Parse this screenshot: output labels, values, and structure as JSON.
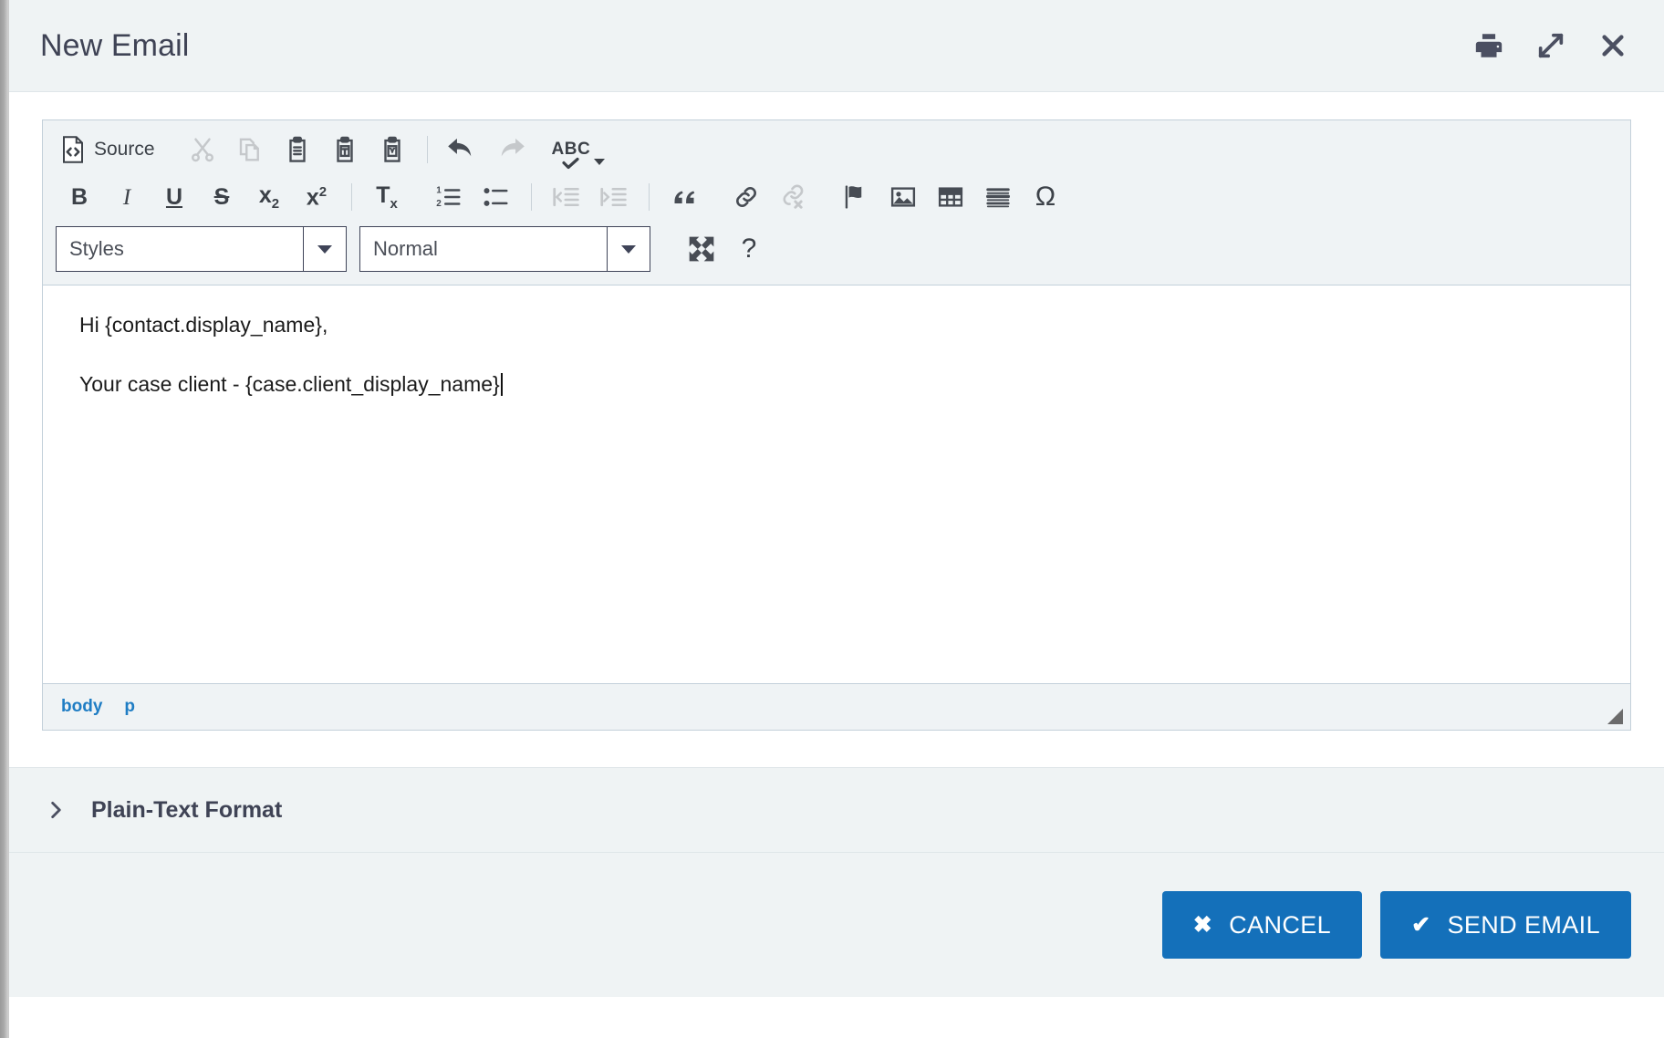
{
  "header": {
    "title": "New Email",
    "actions": [
      {
        "name": "print-icon",
        "label": "Print"
      },
      {
        "name": "expand-icon",
        "label": "Expand"
      },
      {
        "name": "close-icon",
        "label": "Close"
      }
    ]
  },
  "toolbar": {
    "source_label": "Source",
    "row1": [
      {
        "name": "source-button",
        "label": "Source",
        "disabled": false
      },
      {
        "name": "cut-icon",
        "label": "Cut",
        "disabled": true
      },
      {
        "name": "copy-icon",
        "label": "Copy",
        "disabled": true
      },
      {
        "name": "paste-icon",
        "label": "Paste",
        "disabled": false
      },
      {
        "name": "paste-as-text-icon",
        "label": "Paste as plain text",
        "disabled": false
      },
      {
        "name": "paste-from-word-icon",
        "label": "Paste from Word",
        "disabled": false
      },
      {
        "name": "undo-icon",
        "label": "Undo",
        "disabled": false
      },
      {
        "name": "redo-icon",
        "label": "Redo",
        "disabled": true
      },
      {
        "name": "spell-check-icon",
        "label": "Check Spelling",
        "disabled": false
      }
    ],
    "spell_check_text": "ABC",
    "row2": [
      {
        "name": "bold-button",
        "label": "B",
        "disabled": false
      },
      {
        "name": "italic-button",
        "label": "I",
        "disabled": false
      },
      {
        "name": "underline-button",
        "label": "U",
        "disabled": false
      },
      {
        "name": "strikethrough-button",
        "label": "S",
        "disabled": false
      },
      {
        "name": "subscript-button",
        "label": "x",
        "disabled": false
      },
      {
        "name": "superscript-button",
        "label": "x",
        "disabled": false
      },
      {
        "name": "remove-format-icon",
        "label": "Remove Format",
        "disabled": false
      },
      {
        "name": "numbered-list-icon",
        "label": "Insert/Remove Numbered List",
        "disabled": false
      },
      {
        "name": "bulleted-list-icon",
        "label": "Insert/Remove Bulleted List",
        "disabled": false
      },
      {
        "name": "decrease-indent-icon",
        "label": "Decrease Indent",
        "disabled": true
      },
      {
        "name": "increase-indent-icon",
        "label": "Increase Indent",
        "disabled": true
      },
      {
        "name": "blockquote-icon",
        "label": "Block Quote",
        "disabled": false
      },
      {
        "name": "link-icon",
        "label": "Link",
        "disabled": false
      },
      {
        "name": "unlink-icon",
        "label": "Unlink",
        "disabled": true
      },
      {
        "name": "anchor-flag-icon",
        "label": "Anchor",
        "disabled": false
      },
      {
        "name": "image-icon",
        "label": "Image",
        "disabled": false
      },
      {
        "name": "table-icon",
        "label": "Table",
        "disabled": false
      },
      {
        "name": "horizontal-rule-icon",
        "label": "Horizontal Line",
        "disabled": false
      },
      {
        "name": "special-character-icon",
        "label": "Insert Special Character",
        "disabled": false
      }
    ],
    "subscript_char": "x",
    "subscript_index": "2",
    "superscript_char": "x",
    "superscript_index": "2",
    "remove_format_char": "T",
    "remove_format_index": "x",
    "omega_char": "Ω",
    "styles_select": {
      "name": "styles-dropdown",
      "value": "Styles"
    },
    "format_select": {
      "name": "paragraph-format-dropdown",
      "value": "Normal"
    },
    "maximize": {
      "name": "maximize-icon",
      "label": "Maximize"
    },
    "help": {
      "name": "help-icon",
      "label": "About CKEditor",
      "glyph": "?"
    }
  },
  "editor": {
    "paragraphs": [
      "Hi {contact.display_name},",
      "Your case client - {case.client_display_name}"
    ],
    "element_path": [
      "body",
      "p"
    ]
  },
  "plain_text_section": {
    "label": "Plain-Text Format",
    "expanded": false
  },
  "footer": {
    "cancel_label": "CANCEL",
    "cancel_glyph": "✖",
    "send_label": "SEND EMAIL",
    "send_glyph": "✔"
  },
  "colors": {
    "accent_blue": "#1470ba",
    "header_bg": "#eff3f4",
    "toolbar_bg": "#eff3f5",
    "title_text": "#3f4355",
    "path_blue": "#1f7dc4",
    "border": "#c3d0da"
  }
}
